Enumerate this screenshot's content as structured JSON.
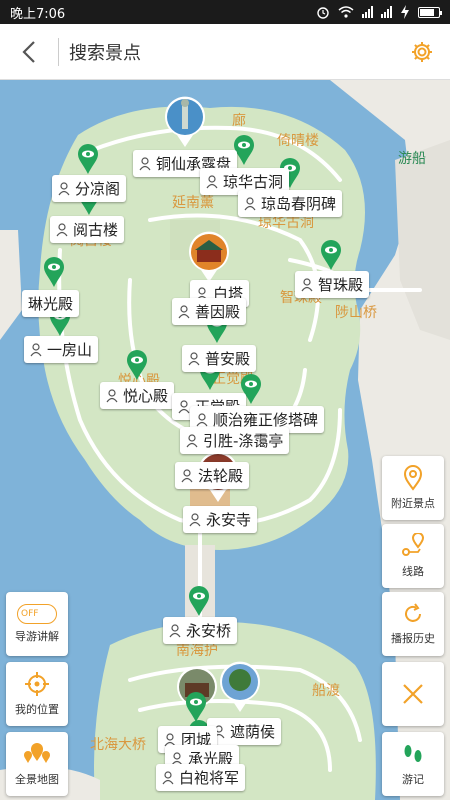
{
  "status_bar": {
    "time": "晚上7:06"
  },
  "header": {
    "title": "搜索景点",
    "back_icon": "chevron-left-icon",
    "settings_icon": "gear-icon"
  },
  "colors": {
    "accent": "#f2a229",
    "pin_green": "#23a45a",
    "water": "#7fb3d9",
    "land": "#d3e6c4",
    "road": "#ffffff"
  },
  "map": {
    "base_labels": {
      "lang": "廊",
      "yiqing": "倚晴楼",
      "youchuan": "游船",
      "yannan": "延南薰",
      "qionghua_gudong": "琼华古洞",
      "yuegu": "阅古楼",
      "zhizhu": "智珠殿",
      "lushan_qiao": "陟山桥",
      "yuexin": "悦心殿",
      "zhengjue": "正觉殿",
      "puan": "普安殿",
      "nanyi": "南海护",
      "chuandu": "船渡",
      "beihai_daqiao": "北海大桥"
    },
    "spots": [
      "铜仙承露盘",
      "分凉阁",
      "琼华古洞",
      "琼岛春阴碑",
      "阅古楼",
      "智珠殿",
      "琳光殿",
      "白塔",
      "善因殿",
      "一房山",
      "普安殿",
      "悦心殿",
      "正觉殿",
      "顺治雍正修塔碑",
      "引胜-涤霭亭",
      "法轮殿",
      "永安寺",
      "永安桥",
      "遮荫侯",
      "团城",
      "承光殿",
      "白袍将军"
    ]
  },
  "side_buttons": {
    "nearby": {
      "label": "附近景点",
      "icon": "location-pin-icon"
    },
    "route": {
      "label": "线路",
      "icon": "route-icon"
    },
    "history": {
      "label": "播报历史",
      "icon": "refresh-icon"
    },
    "close_icon": "close-icon",
    "travel_log": {
      "label": "游记",
      "icon": "footprints-icon"
    },
    "guide": {
      "label": "导游讲解",
      "toggle": "OFF"
    },
    "my_location": {
      "label": "我的位置",
      "icon": "crosshair-icon"
    },
    "panorama": {
      "label": "全景地图",
      "icon": "map-pins-icon"
    }
  }
}
